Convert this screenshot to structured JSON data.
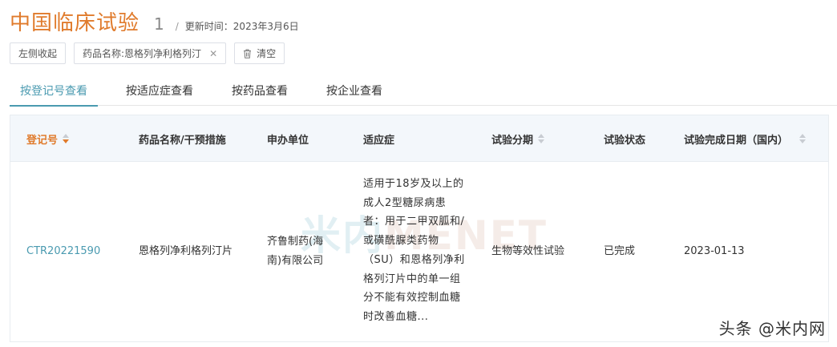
{
  "header": {
    "title": "中国临床试验",
    "count": "1",
    "separator": "/",
    "updated": "更新时间：2023年3月6日"
  },
  "filters": {
    "collapse_label": "左侧收起",
    "drug_chip": "药品名称:恩格列净利格列汀",
    "clear_label": "清空"
  },
  "tabs": [
    {
      "label": "按登记号查看",
      "active": true
    },
    {
      "label": "按适应症查看",
      "active": false
    },
    {
      "label": "按药品查看",
      "active": false
    },
    {
      "label": "按企业查看",
      "active": false
    }
  ],
  "table": {
    "columns": [
      "登记号",
      "药品名称/干预措施",
      "申办单位",
      "适应症",
      "试验分期",
      "试验状态",
      "试验完成日期（国内）"
    ],
    "rows": [
      {
        "reg_no": "CTR20221590",
        "drug": "恩格列净利格列汀片",
        "sponsor": "齐鲁制药(海南)有限公司",
        "indication": "适用于18岁及以上的成人2型糖尿病患者：用于二甲双胍和/或磺酰脲类药物（SU）和恩格列净利格列汀片中的单一组分不能有效控制血糖时改善血糖...",
        "phase": "生物等效性试验",
        "status": "已完成",
        "completion_date": "2023-01-13"
      }
    ]
  },
  "watermark": {
    "cn": "米内",
    "en": "MENET"
  },
  "footer_mark": "头条 @米内网",
  "colors": {
    "accent": "#e07b2c",
    "link": "#4a9ab0"
  }
}
